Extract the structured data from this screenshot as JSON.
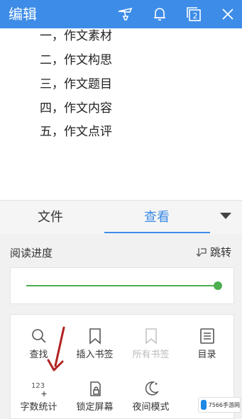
{
  "topbar": {
    "title": "编辑",
    "icons": [
      "hanger-icon",
      "bell-icon",
      "window-count-icon",
      "close-icon"
    ],
    "window_count": "2"
  },
  "document": {
    "lines": [
      "一，作文素材",
      "二，作文构思",
      "三，作文题目",
      "四，作文内容",
      "五，作文点评"
    ]
  },
  "tabs": {
    "file": "文件",
    "view": "查看",
    "active": "查看"
  },
  "reading": {
    "progress_label": "阅读进度",
    "jump_label": "跳转",
    "progress_fraction": 1.0
  },
  "tools": [
    {
      "label": "查找",
      "icon": "search-icon",
      "enabled": true
    },
    {
      "label": "插入书签",
      "icon": "bookmark-icon",
      "enabled": true
    },
    {
      "label": "所有书签",
      "icon": "bookmark-icon",
      "enabled": false
    },
    {
      "label": "目录",
      "icon": "list-icon",
      "enabled": true
    },
    {
      "label": "字数统计",
      "icon": "word-count-icon",
      "enabled": true
    },
    {
      "label": "锁定屏幕",
      "icon": "lock-icon",
      "enabled": true
    },
    {
      "label": "夜间模式",
      "icon": "moon-icon",
      "enabled": true
    }
  ],
  "watermark": "7566手游网",
  "colors": {
    "accent": "#3d8ce8",
    "progress": "#4caf50",
    "annotation_arrow": "#b22222"
  }
}
